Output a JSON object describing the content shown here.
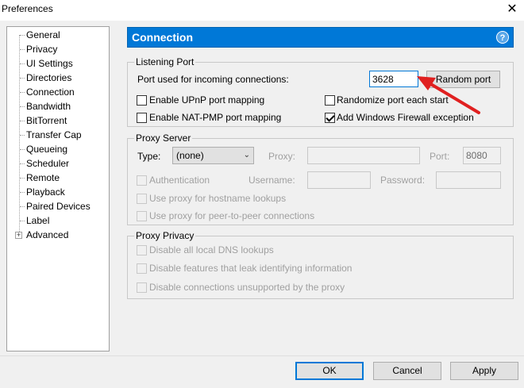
{
  "window": {
    "title": "Preferences",
    "close_glyph": "✕"
  },
  "tree": {
    "items": [
      {
        "label": "General"
      },
      {
        "label": "Privacy"
      },
      {
        "label": "UI Settings"
      },
      {
        "label": "Directories"
      },
      {
        "label": "Connection"
      },
      {
        "label": "Bandwidth"
      },
      {
        "label": "BitTorrent"
      },
      {
        "label": "Transfer Cap"
      },
      {
        "label": "Queueing"
      },
      {
        "label": "Scheduler"
      },
      {
        "label": "Remote"
      },
      {
        "label": "Playback"
      },
      {
        "label": "Paired Devices"
      },
      {
        "label": "Label"
      },
      {
        "label": "Advanced"
      }
    ],
    "selected_index": 4,
    "expander_glyph": "+"
  },
  "header": {
    "title": "Connection",
    "help_glyph": "?"
  },
  "listening_port": {
    "group_label": "Listening Port",
    "port_label": "Port used for incoming connections:",
    "port_value": "3628",
    "random_port_button": "Random port",
    "upnp_label": "Enable UPnP port mapping",
    "upnp_checked": false,
    "natpmp_label": "Enable NAT-PMP port mapping",
    "natpmp_checked": false,
    "randomize_label": "Randomize port each start",
    "randomize_checked": false,
    "firewall_label": "Add Windows Firewall exception",
    "firewall_checked": true
  },
  "proxy_server": {
    "group_label": "Proxy Server",
    "type_label": "Type:",
    "type_value": "(none)",
    "proxy_label": "Proxy:",
    "proxy_value": "",
    "port_label": "Port:",
    "port_value": "8080",
    "auth_label": "Authentication",
    "username_label": "Username:",
    "username_value": "",
    "password_label": "Password:",
    "password_value": "",
    "hostname_label": "Use proxy for hostname lookups",
    "p2p_label": "Use proxy for peer-to-peer connections"
  },
  "proxy_privacy": {
    "group_label": "Proxy Privacy",
    "dns_label": "Disable all local DNS lookups",
    "leak_label": "Disable features that leak identifying information",
    "unsupported_label": "Disable connections unsupported by the proxy"
  },
  "footer": {
    "ok": "OK",
    "cancel": "Cancel",
    "apply": "Apply"
  },
  "colors": {
    "accent": "#0078d7",
    "annotation_arrow": "#e02020"
  }
}
